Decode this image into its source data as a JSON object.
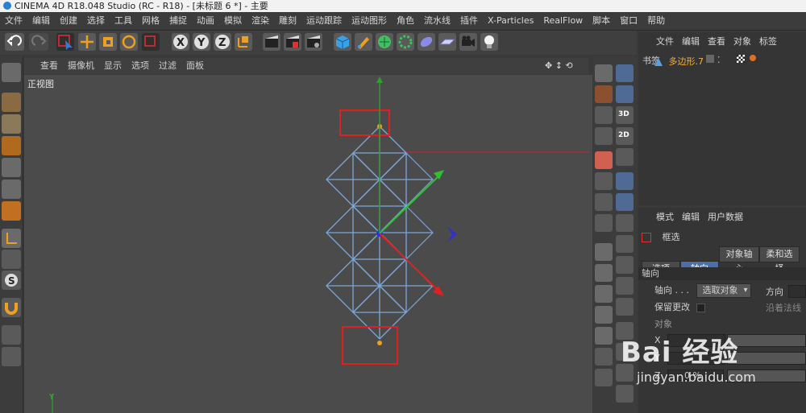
{
  "window": {
    "title": "CINEMA 4D R18.048 Studio (RC - R18) - [未标题 6 *] - 主要"
  },
  "menubar": [
    "文件",
    "编辑",
    "创建",
    "选择",
    "工具",
    "网格",
    "捕捉",
    "动画",
    "模拟",
    "渲染",
    "雕刻",
    "运动跟踪",
    "运动图形",
    "角色",
    "流水线",
    "插件",
    "X-Particles",
    "RealFlow",
    "脚本",
    "窗口",
    "帮助"
  ],
  "viewport": {
    "menu": [
      "查看",
      "摄像机",
      "显示",
      "选项",
      "过滤",
      "面板"
    ],
    "label": "正视图",
    "axis_label": "Y"
  },
  "object_manager": {
    "tabs": [
      "文件",
      "编辑",
      "查看",
      "对象",
      "标签",
      "书签"
    ],
    "object_name": "多边形.7"
  },
  "attribute_manager": {
    "tabs": [
      "模式",
      "编辑",
      "用户数据"
    ],
    "tool_name": "框选",
    "subtabs": [
      "选项",
      "轴向",
      "对象轴心",
      "柔和选择"
    ],
    "active_subtab": "轴向",
    "section_title": "轴向",
    "axis_label": "轴向 . . .",
    "axis_value": "选取对象",
    "direction_label": "方向",
    "keep_changes_label": "保留更改",
    "along_normal_label": "沿着法线",
    "object_label": "对象",
    "x_label": "X",
    "y_label": "Y",
    "z_label": "Z",
    "z_value": "0 %"
  },
  "watermark": {
    "text": "Bai 经验",
    "sub": "jingyan.baidu.com"
  },
  "colors": {
    "accent": "#4b6fa8",
    "selection_red": "#e02020",
    "mesh_blue": "#7ea6d8"
  }
}
